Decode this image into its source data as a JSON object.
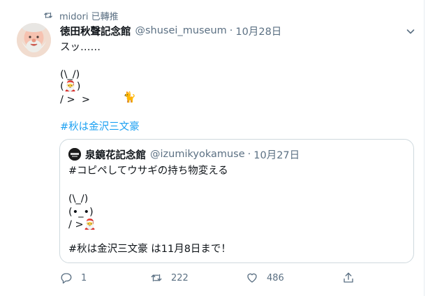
{
  "retweet": {
    "text": "midori 已轉推"
  },
  "tweet": {
    "display_name": "徳田秋聲記念館",
    "handle": "@shusei_museum",
    "separator": "·",
    "date": "10月28日",
    "line1": "スッ……",
    "art1": "(\\_/)",
    "art2_left": "(",
    "art2_emoji": "🎅",
    "art2_right": ")",
    "art3": "/ >  >",
    "cat_emoji": "🐈",
    "hashtag": "#秋は金沢三文豪"
  },
  "quoted": {
    "display_name": "泉鏡花記念館",
    "handle": "@izumikyokamuse",
    "separator": "·",
    "date": "10月27日",
    "line1": "#コピペしてウサギの持ち物変える",
    "art1": "(\\_/)",
    "art2": "(•_•)",
    "art3_prefix": "/ >",
    "art3_emoji": "🎅",
    "line_last": "#秋は金沢三文豪 は11月8日まで！"
  },
  "actions": {
    "reply_count": "1",
    "retweet_count": "222",
    "like_count": "486"
  },
  "colors": {
    "accent": "#1da1f2",
    "secondary_text": "#5b7083",
    "border": "#cfd9de"
  }
}
